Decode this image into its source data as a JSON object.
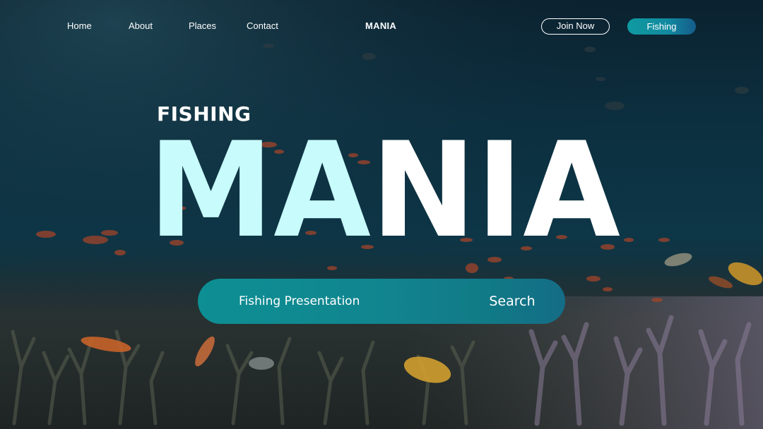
{
  "nav": {
    "links": [
      {
        "label": "Home"
      },
      {
        "label": "About"
      },
      {
        "label": "Places"
      },
      {
        "label": "Contact"
      }
    ],
    "brand": "MANIA",
    "join_label": "Join Now",
    "fishing_label": "Fishing"
  },
  "hero": {
    "eyebrow": "FISHING",
    "title_part1": "MA",
    "title_part2": "NIA"
  },
  "search": {
    "placeholder": "Fishing Presentation",
    "button_label": "Search"
  },
  "colors": {
    "accent_teal": "#0f9aa0",
    "title_cyan": "#c8fbfc",
    "title_white": "#ffffff"
  }
}
